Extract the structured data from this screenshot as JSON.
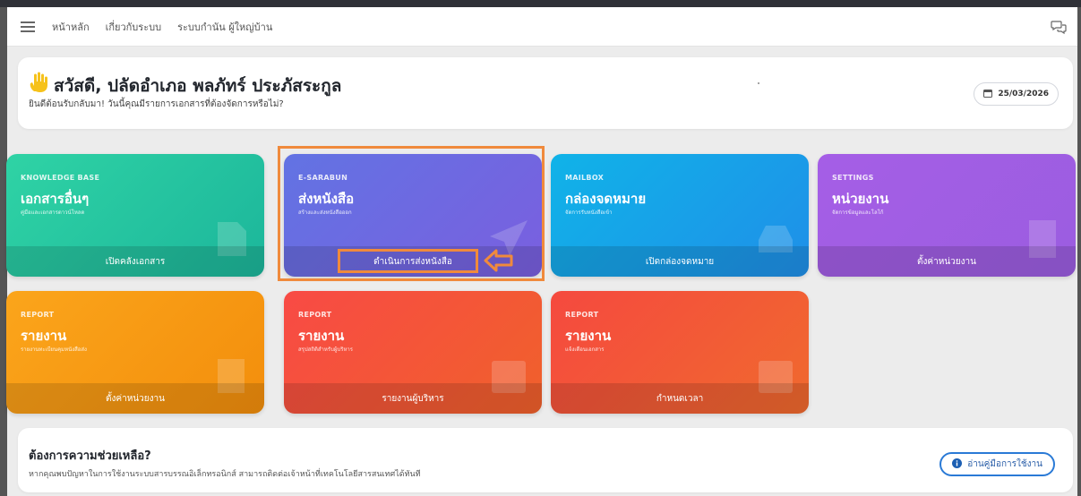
{
  "navbar": {
    "menu_icon": "hamburger-icon",
    "links": [
      "หน้าหลัก",
      "เกี่ยวกับระบบ",
      "ระบบกำนัน ผู้ใหญ่บ้าน"
    ],
    "chat_icon": "chat-icon"
  },
  "welcome": {
    "title": "สวัสดี, ปลัดอำเภอ พลภัทร์ ประภัสระกูล",
    "subtitle": "ยินดีต้อนรับกลับมา! วันนี้คุณมีรายการเอกสารที่ต้องจัดการหรือไม่?",
    "date": "25/03/2026",
    "hand_icon": "waving-hand-icon",
    "calendar_icon": "calendar-icon"
  },
  "cards": [
    {
      "category": "KNOWLEDGE BASE",
      "title": "เอกสารอื่นๆ",
      "desc": "คู่มือและเอกสารดาวน์โหลด",
      "action": "เปิดคลังเอกสาร",
      "icon": "document-icon",
      "color": "#22c3a0"
    },
    {
      "category": "E-SARABUN",
      "title": "ส่งหนังสือ",
      "desc": "สร้างและส่งหนังสือออก",
      "action": "ดำเนินการส่งหนังสือ",
      "icon": "paper-plane-icon",
      "color": "#6a6ae2"
    },
    {
      "category": "MAILBOX",
      "title": "กล่องจดหมาย",
      "desc": "จัดการรับหนังสือเข้า",
      "action": "เปิดกล่องจดหมาย",
      "icon": "inbox-icon",
      "color": "#18a2e8"
    },
    {
      "category": "SETTINGS",
      "title": "หน่วยงาน",
      "desc": "จัดการข้อมูลและโลโก้",
      "action": "ตั้งค่าหน่วยงาน",
      "icon": "building-icon",
      "color": "#a05ee3"
    },
    {
      "category": "REPORT",
      "title": "รายงาน",
      "desc": "รายงานทะเบียนคุมหนังสือส่ง",
      "action": "ตั้งค่าหน่วยงาน",
      "icon": "report-icon",
      "color": "#f79a14"
    },
    {
      "category": "REPORT",
      "title": "รายงาน",
      "desc": "สรุปสถิติสำหรับผู้บริหาร",
      "action": "รายงานผู้บริหาร",
      "icon": "chart-icon",
      "color": "#f45540"
    },
    {
      "category": "REPORT",
      "title": "รายงาน",
      "desc": "แจ้งเตือนเอกสาร",
      "action": "กำหนดเวลา",
      "icon": "chart-icon",
      "color": "#f35c38"
    }
  ],
  "help": {
    "title": "ต้องการความช่วยเหลือ?",
    "desc": "หากคุณพบปัญหาในการใช้งานระบบสารบรรณอิเล็กทรอนิกส์ สามารถติดต่อเจ้าหน้าที่เทคโนโลยีสารสนเทศได้ทันที",
    "button": "อ่านคู่มือการใช้งาน",
    "button_icon": "info-icon"
  },
  "annotation": {
    "color": "#f08a3c",
    "arrow_icon": "left-arrow-icon"
  }
}
